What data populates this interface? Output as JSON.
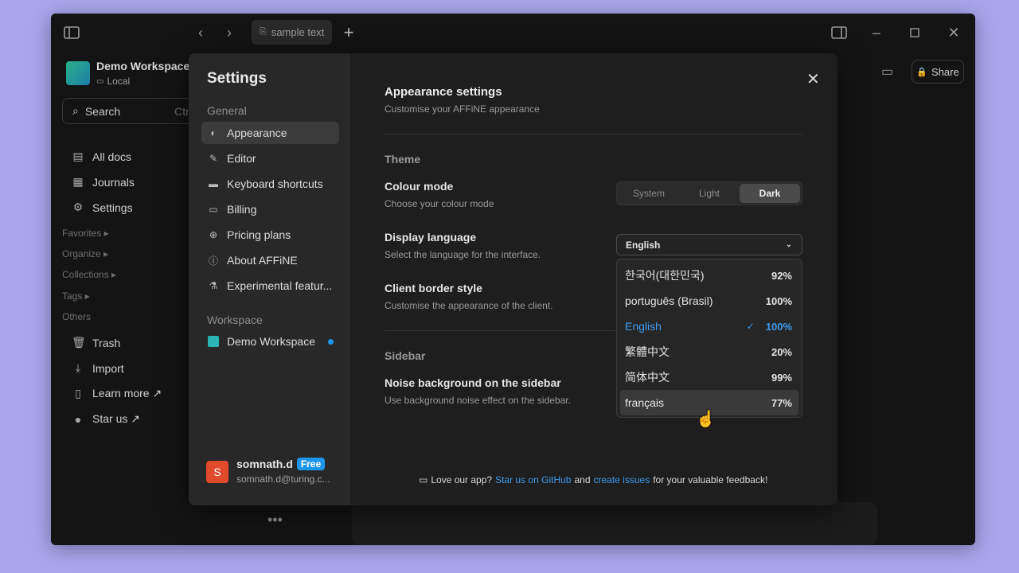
{
  "titlebar": {
    "tab_label": "sample text",
    "icons": [
      "sidebar-toggle-icon",
      "back-arrow-icon",
      "forward-arrow-icon",
      "new-tab-icon",
      "split-view-icon",
      "minimize-icon",
      "maximize-icon",
      "close-icon"
    ]
  },
  "sidebar": {
    "workspace_name": "Demo Workspace",
    "workspace_type": "Local",
    "search_label": "Search",
    "search_shortcut": "Ctrl +",
    "items": [
      {
        "label": "All docs",
        "icon": "docs-icon"
      },
      {
        "label": "Journals",
        "icon": "calendar-icon"
      },
      {
        "label": "Settings",
        "icon": "gear-icon"
      }
    ],
    "sections": [
      "Favorites ▸",
      "Organize ▸",
      "Collections ▸",
      "Tags ▸",
      "Others"
    ],
    "others": [
      {
        "label": "Trash",
        "icon": "trash-icon"
      },
      {
        "label": "Import",
        "icon": "import-icon"
      },
      {
        "label": "Learn more ↗",
        "icon": "book-icon"
      },
      {
        "label": "Star us ↗",
        "icon": "github-icon"
      }
    ]
  },
  "header": {
    "share_label": "Share"
  },
  "settings": {
    "title": "Settings",
    "group_general": "General",
    "nav": [
      {
        "label": "Appearance",
        "icon": "palette-icon",
        "active": true
      },
      {
        "label": "Editor",
        "icon": "pen-icon"
      },
      {
        "label": "Keyboard shortcuts",
        "icon": "keyboard-icon"
      },
      {
        "label": "Billing",
        "icon": "billing-icon"
      },
      {
        "label": "Pricing plans",
        "icon": "arrow-up-circle-icon"
      },
      {
        "label": "About AFFiNE",
        "icon": "info-icon"
      },
      {
        "label": "Experimental featur...",
        "icon": "experiment-icon"
      }
    ],
    "group_workspace": "Workspace",
    "workspace_item": "Demo Workspace",
    "user": {
      "initial": "S",
      "name": "somnath.d",
      "plan_badge": "Free",
      "email": "somnath.d@turing.c..."
    },
    "appearance": {
      "title": "Appearance settings",
      "subtitle": "Customise your AFFiNE appearance",
      "theme_section": "Theme",
      "colour_mode_title": "Colour mode",
      "colour_mode_sub": "Choose your colour mode",
      "colour_modes": [
        "System",
        "Light",
        "Dark"
      ],
      "colour_mode_selected": "Dark",
      "language_title": "Display language",
      "language_sub": "Select the language for the interface.",
      "language_selected": "English",
      "border_title": "Client border style",
      "border_sub": "Customise the appearance of the client.",
      "sidebar_section": "Sidebar",
      "noise_title": "Noise background on the sidebar",
      "noise_sub": "Use background noise effect on the sidebar."
    },
    "language_options": [
      {
        "name": "한국어(대한민국)",
        "percent": "92%"
      },
      {
        "name": "português (Brasil)",
        "percent": "100%"
      },
      {
        "name": "English",
        "percent": "100%",
        "current": true
      },
      {
        "name": "繁體中文",
        "percent": "20%"
      },
      {
        "name": "简体中文",
        "percent": "99%"
      },
      {
        "name": "français",
        "percent": "77%",
        "hover": true
      }
    ],
    "feedback": {
      "prefix": "Love our app?",
      "link1": "Star us on GitHub",
      "middle": "and",
      "link2": "create issues",
      "suffix": "for your valuable feedback!"
    }
  },
  "colors": {
    "accent": "#1e96eb",
    "modal_bg": "#1e1e1e",
    "sidebar_bg": "#282828",
    "window_bg": "#141414",
    "desktop_bg": "#a9a5ec"
  }
}
